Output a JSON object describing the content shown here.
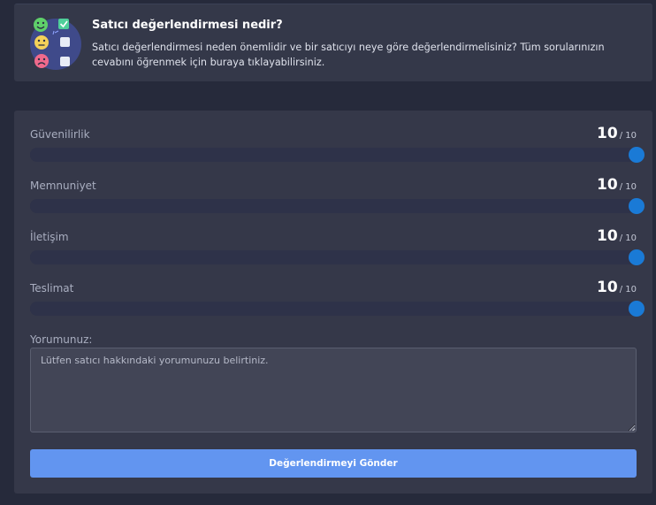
{
  "info": {
    "title": "Satıcı değerlendirmesi nedir?",
    "description_line1": "Satıcı değerlendirmesi neden önemlidir ve bir satıcıyı neye göre değerlendirmelisiniz? Tüm sorularınızın",
    "description_line2": "cevabını öğrenmek için buraya tıklayabilirsiniz.",
    "illustration_icons": [
      "happy-face-icon",
      "neutral-face-icon",
      "sad-face-icon",
      "checkbox-icon"
    ]
  },
  "criteria": [
    {
      "label": "Güvenilirlik",
      "value": "10",
      "max": "/ 10",
      "level": 1.0
    },
    {
      "label": "Memnuniyet",
      "value": "10",
      "max": "/ 10",
      "level": 1.0
    },
    {
      "label": "İletişim",
      "value": "10",
      "max": "/ 10",
      "level": 1.0
    },
    {
      "label": "Teslimat",
      "value": "10",
      "max": "/ 10",
      "level": 1.0
    }
  ],
  "comment": {
    "label": "Yorumunuz:",
    "placeholder": "Lütfen satıcı hakkındaki yorumunuzu belirtiniz.",
    "value": ""
  },
  "submit": {
    "label": "Değerlendirmeyi Gönder"
  },
  "colors": {
    "background": "#262a3b",
    "card": "#353849",
    "slider_thumb": "#1a7ad6",
    "submit_button": "#6295f0"
  }
}
